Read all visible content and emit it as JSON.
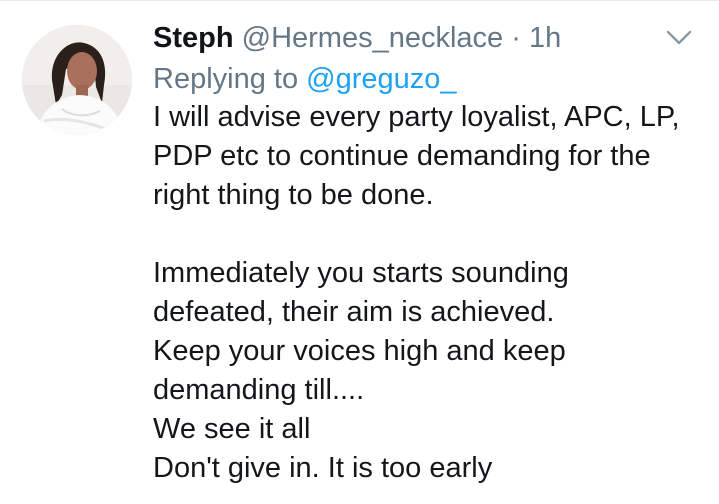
{
  "tweet": {
    "author": {
      "display_name": "Steph",
      "handle": "@Hermes_necklace"
    },
    "separator": "·",
    "time": "1h",
    "reply": {
      "prefix": "Replying to",
      "handle": "@greguzo_"
    },
    "body": {
      "paragraph_1": [
        "I will advise every party loyalist, APC, LP,",
        "PDP etc to continue demanding for the",
        "right thing to be done."
      ],
      "paragraph_2": [
        "Immediately you starts sounding",
        "defeated, their aim is achieved.",
        "Keep your voices high and keep",
        "demanding till....",
        "We see it all",
        "Don't give in. It is too early"
      ]
    },
    "icons": {
      "menu": "chevron-down-icon",
      "avatar": "avatar"
    },
    "colors": {
      "link": "#1da1f2",
      "secondary_text": "#657786",
      "primary_text": "#14171a"
    }
  }
}
